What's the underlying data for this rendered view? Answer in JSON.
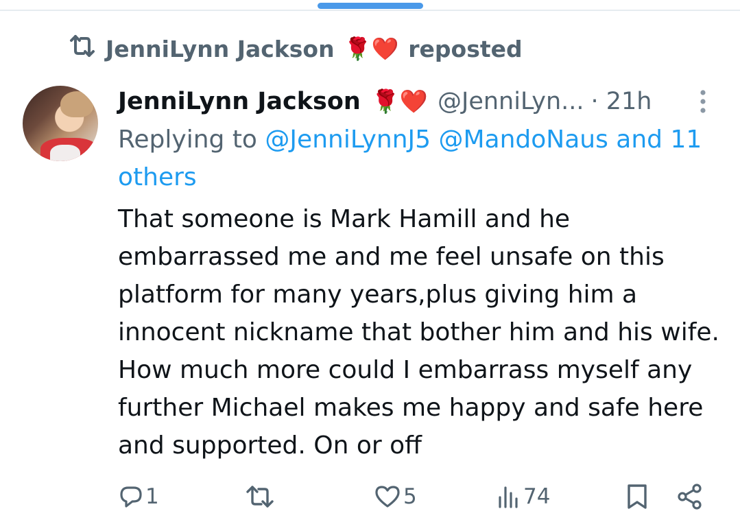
{
  "repost": {
    "icon": "repost-icon",
    "user": "JenniLynn Jackson",
    "emojis": "🌹❤️",
    "label": "reposted"
  },
  "tweet": {
    "display_name": "JenniLynn Jackson",
    "name_emojis": "🌹❤️",
    "handle": "@JenniLyn...",
    "time": "· 21h",
    "replying_to_label": "Replying to",
    "replying_to_mentions": "@JenniLynnJ5 @MandoNaus and 11 others",
    "text": "That someone is Mark Hamill and he embarrassed me and me feel unsafe on this platform for many years,plus giving him a innocent nickname that bother him and his wife. How much more could I embarrass myself any further Michael makes me happy and safe here and supported. On or off"
  },
  "actions": {
    "replies": "1",
    "reposts": "",
    "likes": "5",
    "views": "74"
  },
  "colors": {
    "text_primary": "#0f1419",
    "text_secondary": "#536471",
    "accent": "#1d9bf0",
    "scroll_indicator": "#4a99e9"
  }
}
